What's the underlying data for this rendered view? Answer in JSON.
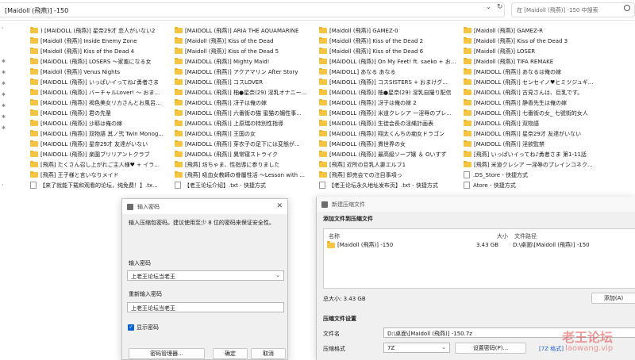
{
  "explorer": {
    "address": "[Maidoll (飛燕)] -150",
    "search_placeholder": "在 [Maidoll (飛燕)] -150 中搜索",
    "columns": [
      [
        {
          "type": "folder",
          "name": ") [MAIDOLL (飛燕)] 星奈29才 恋人がいない2"
        },
        {
          "type": "folder",
          "name": "[Maidoll (飛燕)] Inside Enemy Zone"
        },
        {
          "type": "folder",
          "name": "[Maidoll (飛燕)] Kiss of the Dead 4"
        },
        {
          "type": "folder",
          "name": "[MAIDOLL (飛燕)] LOSERS ～家畜になる女"
        },
        {
          "type": "folder",
          "name": "[Maidoll (飛燕)] Venus Nights"
        },
        {
          "type": "folder",
          "name": "[MAIDOLL (飛燕)] いっぱいイってね♪勇者さま"
        },
        {
          "type": "folder",
          "name": "[MAIDOLL (飛燕)] バーチャルLover! ～ おま..."
        },
        {
          "type": "folder",
          "name": "[MAIDOLL (飛燕)] 褐色美女リカさんとお風呂..."
        },
        {
          "type": "folder",
          "name": "[MAIDOLL (飛燕)] 君の先輩"
        },
        {
          "type": "folder",
          "name": "[MAIDOLL (飛燕)] 沙耶は俺の嫁"
        },
        {
          "type": "folder",
          "name": "[MAIDOLL (飛燕)] 双物語 其ノ弐 Twin Monog..."
        },
        {
          "type": "folder",
          "name": "[MAIDOLL (飛燕)] 星奈29才 友達がいない"
        },
        {
          "type": "folder",
          "name": "[MAIDOLL (飛燕)] 楽園ブリリアントクラブ"
        },
        {
          "type": "folder",
          "name": "[飛燕] たくさん召し上がれご主人様♥ + イラ..."
        },
        {
          "type": "folder",
          "name": "[飛燕] 王子様と言いなりメイド"
        },
        {
          "type": "file",
          "name": "【来了就能下载和观看的论坛，纯免费！】.tx..."
        }
      ],
      [
        {
          "type": "folder",
          "name": "[MAIDOLL (飛燕)] ARIA THE AQUAMARINE"
        },
        {
          "type": "folder",
          "name": "[Maidoll (飛燕)] Kiss of the Dead"
        },
        {
          "type": "folder",
          "name": "[Maidoll (飛燕)] Kiss of the Dead 5"
        },
        {
          "type": "folder",
          "name": "[MAIDOLL (飛燕)] Mighty Maid!"
        },
        {
          "type": "folder",
          "name": "[MAIDOLL (飛燕)] アクアマリン After Story"
        },
        {
          "type": "folder",
          "name": "[MAIDOLL (飛燕)] コスLOVER"
        },
        {
          "type": "folder",
          "name": "[MAIDOLL (飛燕)] 柚●星奈(29) 淫乳オナニー..."
        },
        {
          "type": "folder",
          "name": "[MAIDOLL (飛燕)] 冴子は俺の嫁"
        },
        {
          "type": "folder",
          "name": "[MAIDOLL (飛燕)] 六番街の猫 蜜猫の媚性事..."
        },
        {
          "type": "folder",
          "name": "[MAIDOLL (飛燕)] 上原瑞の特別性指導"
        },
        {
          "type": "folder",
          "name": "[MAIDOLL (飛燕)] 王国の女"
        },
        {
          "type": "folder",
          "name": "[MAIDOLL (飛燕)] 芽衣子の足下には変態が..."
        },
        {
          "type": "folder",
          "name": "[MAIDOLL (飛燕)] 異常寝ストライク"
        },
        {
          "type": "folder",
          "name": "[飛燕] 坊ちゃま、性指導に参りました"
        },
        {
          "type": "folder",
          "name": "[飛燕] 吸血女教師の眷屬性活 ～Lesson with ..."
        },
        {
          "type": "file",
          "name": "【老王论坛介绍】.txt - 快捷方式"
        }
      ],
      [
        {
          "type": "folder",
          "name": "[Maidoll (飛燕)] GAMEZ-0"
        },
        {
          "type": "folder",
          "name": "[Maidoll (飛燕)] Kiss of the Dead 2"
        },
        {
          "type": "folder",
          "name": "[Maidoll (飛燕)] Kiss of the Dead 6"
        },
        {
          "type": "folder",
          "name": "[MAIDOLL (飛燕)] On My Feet! ft. saeko + お..."
        },
        {
          "type": "folder",
          "name": "[MAIDOLL] あなる あなる"
        },
        {
          "type": "folder",
          "name": "[MAIDOLL (飛燕)] コスSISTERS + おまけグ..."
        },
        {
          "type": "folder",
          "name": "[MAIDOLL (飛燕)] 柚●星奈(29) 淫乳自撮り配信"
        },
        {
          "type": "folder",
          "name": "[MAIDOLL (飛燕)] 冴子は俺の嫁 2"
        },
        {
          "type": "folder",
          "name": "[MAIDOLL (飛燕)] 米道クレシア 一淫辱のプレ..."
        },
        {
          "type": "folder",
          "name": "[MAIDOLL (飛燕)] 生徒会長の淫縄計画表"
        },
        {
          "type": "folder",
          "name": "[MAIDOLL (飛燕)] 翔太くんちの痴女ドラゴン"
        },
        {
          "type": "folder",
          "name": "[MAIDOLL (飛燕)] 貫世界の女"
        },
        {
          "type": "folder",
          "name": "[MAIDOLL (飛燕)] 最高級ソープ嬢 ＆ Oいすず"
        },
        {
          "type": "folder",
          "name": "[飛燕] 近所の巨乳人妻エルフ1"
        },
        {
          "type": "folder",
          "name": "[飛燕] 即売会での注目事項っ"
        },
        {
          "type": "file",
          "name": "【老王论坛永久地址发布页】.txt - 快捷方式"
        }
      ],
      [
        {
          "type": "folder",
          "name": "[Maidoll (飛燕)] GAMEZ-R"
        },
        {
          "type": "folder",
          "name": "[Maidoll (飛燕)] Kiss of the Dead 3"
        },
        {
          "type": "folder",
          "name": "[Maidoll (飛燕)] LOSER"
        },
        {
          "type": "folder",
          "name": "[Maidoll (飛燕)] TIFA REMAKE"
        },
        {
          "type": "folder",
          "name": "[MAIDOLL (飛燕)] あなるは俺の嫁"
        },
        {
          "type": "folder",
          "name": "[MAIDOLL (飛燕)] センセイノ♥ヒミツジュギ..."
        },
        {
          "type": "folder",
          "name": "[MAIDOLL (飛燕)] 古見さんは、巨乳です。"
        },
        {
          "type": "folder",
          "name": "[MAIDOLL (飛燕)] 静香先生は俺の嫁"
        },
        {
          "type": "folder",
          "name": "[MAIDOLL (飛燕)] 七番街の女_ 七號街的女人"
        },
        {
          "type": "folder",
          "name": "[MAIDOLL (飛燕)] 双物語"
        },
        {
          "type": "folder",
          "name": "[MAIDOLL (飛燕)] 星奈29才 友達がいない"
        },
        {
          "type": "folder",
          "name": "[MAIDOLL (飛燕)] 淫欲監禁"
        },
        {
          "type": "folder",
          "name": "[飛燕] いっぱいイってね♪勇者さま 第1-11話"
        },
        {
          "type": "folder",
          "name": "[飛燕] 米道クレシア 一淫辱のプレインコネク..."
        },
        {
          "type": "file",
          "name": ".DS_Store - 快捷方式"
        },
        {
          "type": "file",
          "name": "Atore - 快捷方式"
        }
      ]
    ]
  },
  "password_dialog": {
    "title": "输入密码",
    "message": "输入压缩包密码。建议使用至少 8 位的密码来保证安全性。",
    "enter_label": "输入密码",
    "password_value": "上老王论坛当老王",
    "reenter_label": "重新输入密码",
    "reenter_value": "上老王论坛当老王",
    "show_password_label": "显示密码",
    "manager_button": "密码管理器...",
    "ok_button": "确定",
    "cancel_button": "取消"
  },
  "archive_dialog": {
    "title": "新建压缩文件",
    "add_section": "添加文件到压缩文件",
    "col_name": "名称",
    "col_size": "大小",
    "col_path": "文件路径",
    "row_name": "[Maidoll (飛燕)] -150",
    "row_size": "3.43 GB",
    "row_path": "D:\\桌面\\[Maidoll (飛燕)] -150",
    "total_size": "总大小: 3.43 GB",
    "add_button": "添加(A)",
    "settings_section": "压缩文件设置",
    "filename_label": "文件名",
    "filename_value": "D:\\桌面\\[Maidoll (飛燕)] -150.7z",
    "format_label": "压缩格式",
    "format_value": "7Z",
    "set_password_button": "设置密码(P)...",
    "format_link": "[7Z 格式]"
  },
  "watermark": {
    "line1": "老王论坛",
    "line2": "laowang.vip"
  }
}
